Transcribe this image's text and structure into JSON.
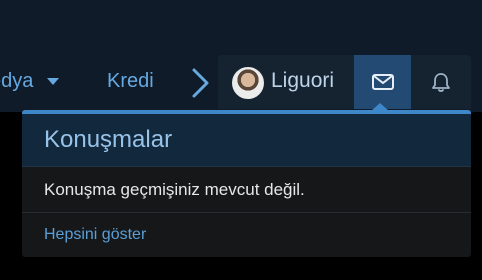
{
  "nav": {
    "medya_label": "edya",
    "kredi_label": "Kredi"
  },
  "user": {
    "name": "Liguori"
  },
  "icons": {
    "mail": "mail-icon",
    "bell": "bell-icon",
    "caret": "chevron-down-icon",
    "arrow": "chevron-right-icon"
  },
  "colors": {
    "accent": "#3e87c8",
    "link": "#66a9e0",
    "header_bg": "#0f1b29",
    "active_tab": "#234a72"
  },
  "conversations_menu": {
    "title": "Konuşmalar",
    "empty_message": "Konuşma geçmişiniz mevcut değil.",
    "show_all_label": "Hepsini göster"
  }
}
